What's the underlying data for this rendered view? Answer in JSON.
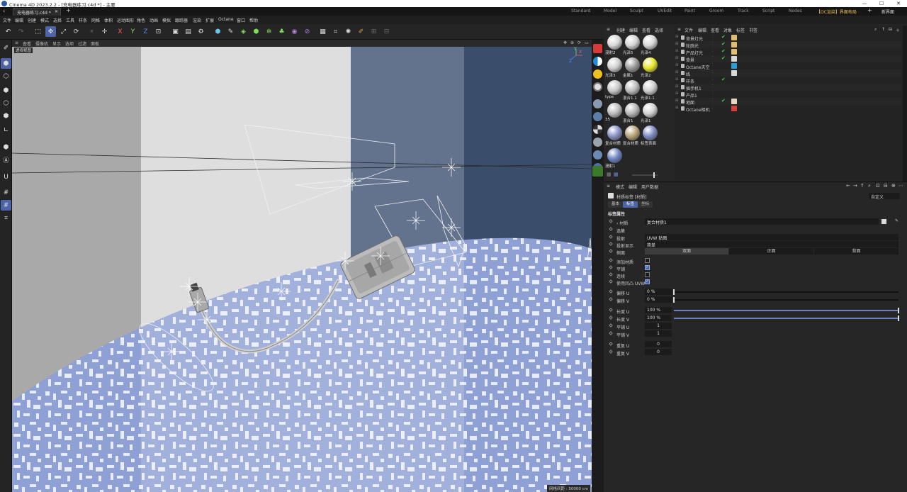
{
  "titlebar": {
    "title": "Cinema 4D 2023.2.2 - [充电器练习.c4d *] - 主要",
    "win_min": "—",
    "win_max": "☐",
    "win_close": "✕"
  },
  "file_tab": {
    "label": "充电器练习.c4d *",
    "close": "✕",
    "add": "+"
  },
  "layouts": [
    "Standard",
    "Model",
    "Sculpt",
    "UVEdit",
    "Paint",
    "Groom",
    "Track",
    "Script",
    "Nodes",
    "【OC渲染】界面布局"
  ],
  "layout_add": "+",
  "new_interface": "新界面",
  "menu": [
    "文件",
    "编辑",
    "创建",
    "模式",
    "选择",
    "工具",
    "样条",
    "网格",
    "体积",
    "运动图形",
    "角色",
    "动画",
    "模拟",
    "跟踪器",
    "渲染",
    "扩展",
    "Octane",
    "窗口",
    "帮助"
  ],
  "viewport": {
    "menu": [
      "查看",
      "摄像机",
      "显示",
      "选项",
      "过滤",
      "面板"
    ],
    "label": "透视视图",
    "scale": "网格间距 : 50000 cm",
    "axis_x": "X",
    "axis_y": "Y",
    "axis_z": "Z"
  },
  "material_manager": {
    "menu": [
      "创建",
      "编辑",
      "查看",
      "选择"
    ],
    "materials": [
      {
        "label": "漫射2",
        "color": "#d8d8d8"
      },
      {
        "label": "光泽5",
        "color": "#d4d4d4"
      },
      {
        "label": "光泽4",
        "color": "#d8d8d8"
      },
      {
        "label": "光泽3",
        "color": "#cfcfcf"
      },
      {
        "label": "金属1",
        "color": "#9a9a9a"
      },
      {
        "label": "光泽2",
        "color": "#e6e62a"
      },
      {
        "label": "type",
        "color": "#c8c8c8"
      },
      {
        "label": "混合1.1",
        "color": "#bdbdbd"
      },
      {
        "label": "光泽1.1",
        "color": "#d0d0d0"
      },
      {
        "label": "35",
        "color": "#bdbdbd"
      },
      {
        "label": "混合1",
        "color": "#b8b8b8"
      },
      {
        "label": "光泽1",
        "color": "#d4d4d4"
      },
      {
        "label": "复合材质",
        "color": "#8a93c6"
      },
      {
        "label": "复合材质",
        "color": "#b9a47a"
      },
      {
        "label": "标签表面",
        "color": "#7d8cc4"
      },
      {
        "label": "漫射1",
        "color": "#6f85c0"
      }
    ]
  },
  "object_manager": {
    "menu": [
      "文件",
      "编辑",
      "查看",
      "对象",
      "标签",
      "书签"
    ],
    "objects": [
      {
        "name": "背景灯光",
        "check": "✔",
        "tag": "#e0c070",
        "dot": "#555"
      },
      {
        "name": "轮廓光",
        "check": "✔",
        "tag": "#e0c070",
        "dot": "#555"
      },
      {
        "name": "产品灯光",
        "check": "✔",
        "tag": "#e0c070",
        "dot": "#555"
      },
      {
        "name": "背景",
        "check": "✔",
        "tag": "#d9d9d9",
        "dot": "#555"
      },
      {
        "name": "Octane天空",
        "check": "",
        "tag": "#2a9fd6",
        "dot": "#555"
      },
      {
        "name": "线",
        "check": "",
        "tag": "#d9d9d9",
        "dot": "#555"
      },
      {
        "name": "样条",
        "check": "✔",
        "tag": "",
        "dot": "#555"
      },
      {
        "name": "插手机1",
        "check": "",
        "tag": "",
        "dot": "#555"
      },
      {
        "name": "产品1",
        "check": "",
        "tag": "",
        "dot": "#555"
      },
      {
        "name": "地面",
        "check": "✔",
        "tag": "#e9d6c0",
        "dot": "#555"
      },
      {
        "name": "Octane相机",
        "check": "",
        "tag": "#d84040",
        "dot": "#555"
      }
    ]
  },
  "attributes": {
    "menu": [
      "模式",
      "编辑",
      "用户数据"
    ],
    "header": "材质标签 [材质]",
    "preset": "自定义",
    "tabs": [
      "基本",
      "标签",
      "坐标"
    ],
    "section": "标签属性",
    "material_label": "材质",
    "material_value": "复合材质1",
    "selection_label": "选集",
    "projection_label": "投射",
    "projection_value": "UVW 贴图",
    "projection_display_label": "投射显示",
    "projection_display_value": "简单",
    "side_label": "侧面",
    "side_options": [
      "双面",
      "正面",
      "背面"
    ],
    "checks": [
      {
        "label": "添加材质",
        "on": false
      },
      {
        "label": "平铺",
        "on": true
      },
      {
        "label": "连续",
        "on": false
      },
      {
        "label": "使用凹凸 UVW",
        "on": true
      }
    ],
    "numeric": [
      {
        "label": "偏移 U",
        "value": "0 %",
        "fraction": 0.0
      },
      {
        "label": "偏移 V",
        "value": "0 %",
        "fraction": 0.0
      },
      {
        "label": "长度 U",
        "value": "100 %",
        "fraction": 1.0
      },
      {
        "label": "长度 V",
        "value": "100 %",
        "fraction": 1.0
      }
    ],
    "tiles": [
      {
        "label": "平铺 U",
        "value": "1"
      },
      {
        "label": "平铺 V",
        "value": "1"
      }
    ],
    "repeats": [
      {
        "label": "重复 U",
        "value": "0"
      },
      {
        "label": "重复 V",
        "value": "0"
      }
    ]
  }
}
